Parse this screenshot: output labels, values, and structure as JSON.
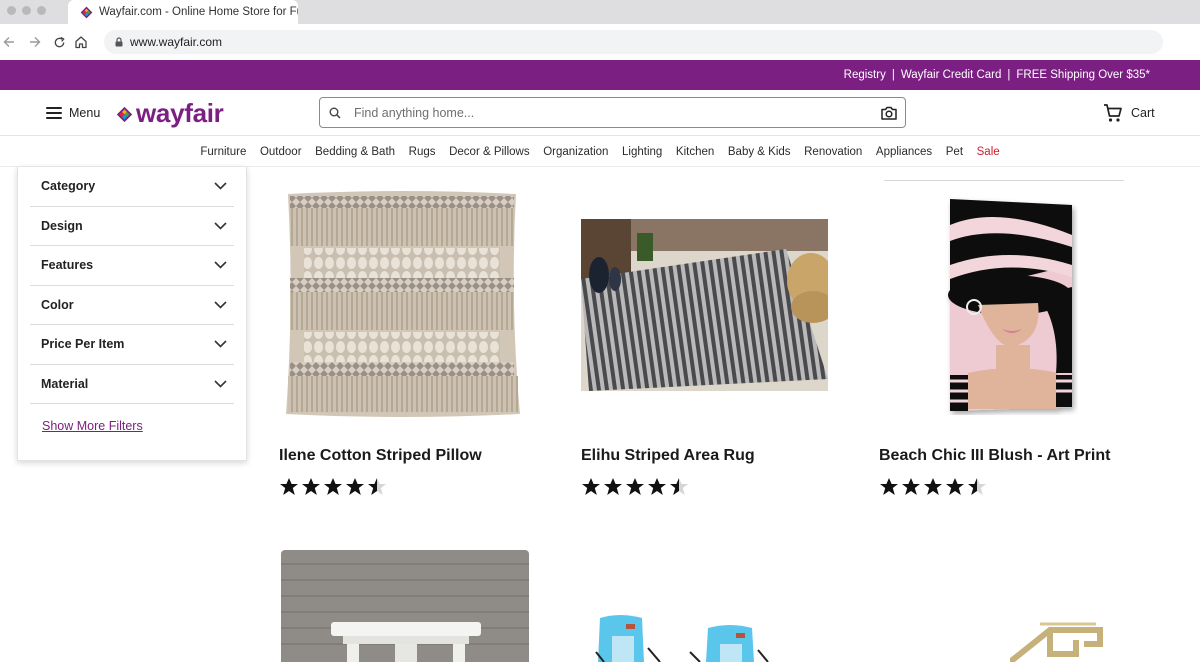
{
  "browser": {
    "tab_title": "Wayfair.com - Online Home Store for Furniture, Decor, Outdoors & More",
    "url": "www.wayfair.com"
  },
  "promo_bar": {
    "background": "#7b1f83",
    "links": [
      "Registry",
      "Wayfair Credit Card",
      "FREE Shipping Over $35*"
    ],
    "separator": "|"
  },
  "header": {
    "menu_label": "Menu",
    "logo_text": "wayfair",
    "brand_color": "#7b1f83",
    "search_placeholder": "Find anything home...",
    "cart_label": "Cart"
  },
  "categories": [
    "Furniture",
    "Outdoor",
    "Bedding & Bath",
    "Rugs",
    "Decor & Pillows",
    "Organization",
    "Lighting",
    "Kitchen",
    "Baby & Kids",
    "Renovation",
    "Appliances",
    "Pet",
    "Sale"
  ],
  "sale_color": "#cf1c2e",
  "filters": {
    "items": [
      "Category",
      "Design",
      "Features",
      "Color",
      "Price Per Item",
      "Material"
    ],
    "show_more": "Show More Filters"
  },
  "products": [
    {
      "name": "Ilene Cotton Striped Pillow",
      "rating": 4.5,
      "image": "pillow-image"
    },
    {
      "name": "Elihu Striped Area Rug",
      "rating": 4.5,
      "image": "rug-image"
    },
    {
      "name": "Beach Chic III Blush - Art Print",
      "rating": 4.5,
      "image": "art-print-image"
    }
  ]
}
